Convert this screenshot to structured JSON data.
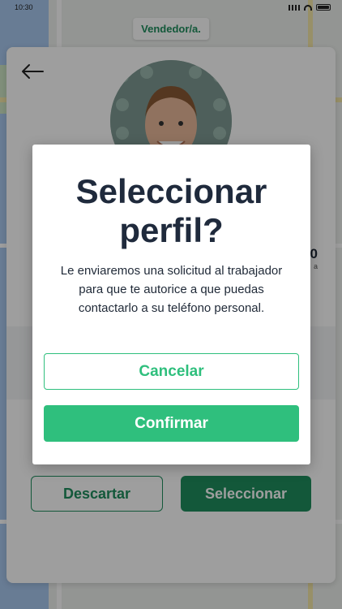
{
  "status_bar": {
    "time": "10:30"
  },
  "role_chip": {
    "label": "Vendedor/a."
  },
  "profile_card": {
    "stat_value": "0",
    "stat_sub": "a",
    "discard_label": "Descartar",
    "select_label": "Seleccionar"
  },
  "modal": {
    "title": "Seleccionar perfil?",
    "message": "Le enviaremos una solicitud al trabajador para que te autorice a que puedas contactarlo a su teléfono personal.",
    "cancel_label": "Cancelar",
    "confirm_label": "Confirmar"
  },
  "colors": {
    "brand_green": "#2fbf7d",
    "brand_green_dark": "#1f8f5e",
    "title_text": "#1f2a3c"
  },
  "icons": {
    "back": "arrow-left-icon",
    "signal": "signal-icon",
    "wifi": "wifi-icon",
    "battery": "battery-icon"
  }
}
